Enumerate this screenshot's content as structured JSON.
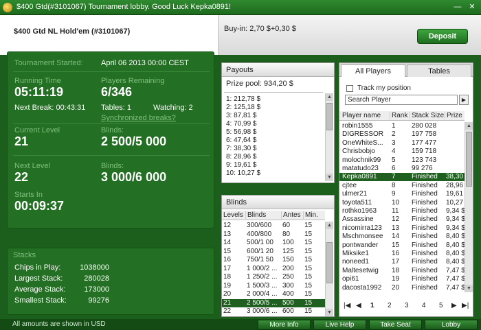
{
  "window": {
    "title": "$400 Gtd(#3101067) Tournament lobby. Good Luck Kepka0891!",
    "minimize_glyph": "—",
    "close_glyph": "✕"
  },
  "header": {
    "game_name": "$400 Gtd NL Hold'em (#3101067)",
    "buyin": "Buy-in: 2,70 $+0,30 $",
    "deposit_label": "Deposit"
  },
  "tournament": {
    "started_label": "Tournament Started:",
    "started_value": "April 06 2013  00:00 CEST",
    "running_label": "Running Time",
    "running_value": "05:11:19",
    "remaining_label": "Players Remaining",
    "remaining_value": "6/346",
    "next_break": "Next Break: 00:43:31",
    "tables": "Tables: 1",
    "watching": "Watching: 2",
    "sync_link": "Synchronized breaks?",
    "current_level_label": "Current Level",
    "current_level_value": "21",
    "blinds_label": "Blinds:",
    "current_blinds": "2 500/5 000",
    "next_level_label": "Next Level",
    "next_level_value": "22",
    "next_blinds": "3 000/6 000",
    "starts_in_label": "Starts In",
    "starts_in_value": "00:09:37"
  },
  "stacks": {
    "title": "Stacks",
    "rows": [
      {
        "name": "Chips in Play:",
        "value": "1038000"
      },
      {
        "name": "Largest Stack:",
        "value": "280028"
      },
      {
        "name": "Average Stack:",
        "value": "173000"
      },
      {
        "name": "Smallest Stack:",
        "value": "99276"
      }
    ]
  },
  "payouts": {
    "title": "Payouts",
    "prize_pool": "Prize pool: 934,20 $",
    "items": [
      "1: 212,78 $",
      "2: 125,18 $",
      "3: 87,81 $",
      "4: 70,99 $",
      "5: 56,98 $",
      "6: 47,64 $",
      "7: 38,30 $",
      "8: 28,96 $",
      "9: 19,61 $",
      "10: 10,27 $"
    ]
  },
  "blinds": {
    "title": "Blinds",
    "headers": [
      "Levels",
      "Blinds",
      "Antes",
      "Min."
    ],
    "rows": [
      [
        "12",
        "300/600",
        "60",
        "15"
      ],
      [
        "13",
        "400/800",
        "80",
        "15"
      ],
      [
        "14",
        "500/1 00",
        "100",
        "15"
      ],
      [
        "15",
        "600/1 20",
        "125",
        "15"
      ],
      [
        "16",
        "750/1 50",
        "150",
        "15"
      ],
      [
        "17",
        "1 000/2 ...",
        "200",
        "15"
      ],
      [
        "18",
        "1 250/2 ...",
        "250",
        "15"
      ],
      [
        "19",
        "1 500/3 ...",
        "300",
        "15"
      ],
      [
        "20",
        "2 000/4 ...",
        "400",
        "15"
      ],
      [
        "21",
        "2 500/5 ...",
        "500",
        "15"
      ],
      [
        "22",
        "3 000/6 ...",
        "600",
        "15"
      ]
    ],
    "highlight_index": 9
  },
  "players": {
    "tab_all": "All Players",
    "tab_tables": "Tables",
    "track_label": "Track my position",
    "search_placeholder": "Search Player",
    "search_go": "▶",
    "headers": [
      "Player name",
      "Rank",
      "Stack Size",
      "Prize"
    ],
    "rows": [
      [
        "robin1555",
        "1",
        "280 028",
        ""
      ],
      [
        "DIGRESSOR",
        "2",
        "197 758",
        ""
      ],
      [
        "OneWhiteS...",
        "3",
        "177 477",
        ""
      ],
      [
        "Chrisbobjo",
        "4",
        "159 718",
        ""
      ],
      [
        "molochnik99",
        "5",
        "123 743",
        ""
      ],
      [
        "matatudo23",
        "6",
        "99 276",
        ""
      ],
      [
        "Kepka0891",
        "7",
        "Finished",
        "38,30 $"
      ],
      [
        "cjtee",
        "8",
        "Finished",
        "28,96 $"
      ],
      [
        "ulmer21",
        "9",
        "Finished",
        "19,61 $"
      ],
      [
        "toyota511",
        "10",
        "Finished",
        "10,27 $"
      ],
      [
        "rothko1963",
        "11",
        "Finished",
        "9,34 $"
      ],
      [
        "Assassine",
        "12",
        "Finished",
        "9,34 $"
      ],
      [
        "nicomirra123",
        "13",
        "Finished",
        "9,34 $"
      ],
      [
        "Mschmonsee",
        "14",
        "Finished",
        "8,40 $"
      ],
      [
        "pontwander",
        "15",
        "Finished",
        "8,40 $"
      ],
      [
        "Miksike1",
        "16",
        "Finished",
        "8,40 $"
      ],
      [
        "noneed1",
        "17",
        "Finished",
        "8,40 $"
      ],
      [
        "Maltesetwig",
        "18",
        "Finished",
        "7,47 $"
      ],
      [
        "opi61",
        "19",
        "Finished",
        "7,47 $"
      ],
      [
        "dacosta1992",
        "20",
        "Finished",
        "7,47 $"
      ]
    ],
    "highlight_index": 6,
    "pages": [
      "1",
      "2",
      "3",
      "4",
      "5"
    ],
    "pager_glyphs": [
      "|◀",
      "◀",
      "▶",
      "▶|"
    ]
  },
  "footer": {
    "note": "All amounts are shown in USD",
    "buttons": [
      "More Info",
      "Live Help",
      "Take Seat",
      "Lobby"
    ]
  }
}
